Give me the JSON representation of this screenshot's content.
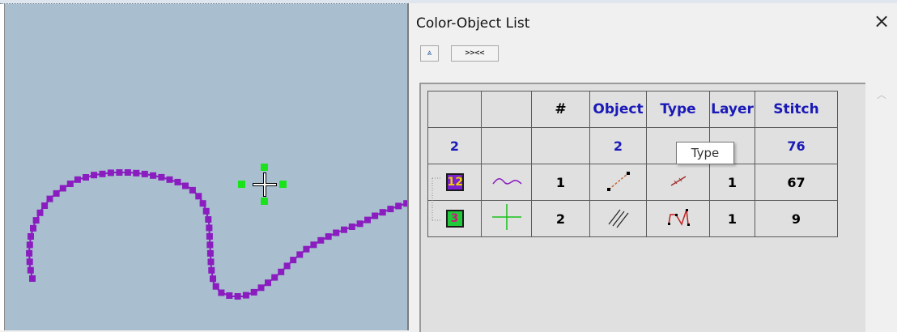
{
  "panel": {
    "title": "Color-Object List",
    "close_glyph": "×",
    "collapse_icon": "double-chevron-up-icon",
    "collapse_glyph": "⩓",
    "expand_label": ">><<"
  },
  "table": {
    "headers": [
      "",
      "",
      "#",
      "Object",
      "Type",
      "Layer",
      "Stitch"
    ],
    "summary": {
      "count": "2",
      "objects": "2",
      "stitch": "76"
    },
    "rows": [
      {
        "color_num": "12",
        "color_hex": "#7a1fd1",
        "color_text_hex": "#f0d000",
        "preview_icon": "purple-wave-icon",
        "num": "1",
        "object_icon": "running-stitch-line-icon",
        "type_icon": "diagonal-stitch-icon",
        "layer": "1",
        "stitch": "67"
      },
      {
        "color_num": "3",
        "color_hex": "#21c83a",
        "color_text_hex": "#d0167a",
        "preview_icon": "green-cross-icon",
        "num": "2",
        "object_icon": "satin-fill-icon",
        "type_icon": "n-shape-path-icon",
        "layer": "1",
        "stitch": "9"
      }
    ]
  },
  "tooltip": {
    "text": "Type"
  },
  "colors": {
    "stitch_color": "#8a1cc0",
    "handle_color": "#1be31b",
    "canvas_bg": "#a9bfcf"
  }
}
